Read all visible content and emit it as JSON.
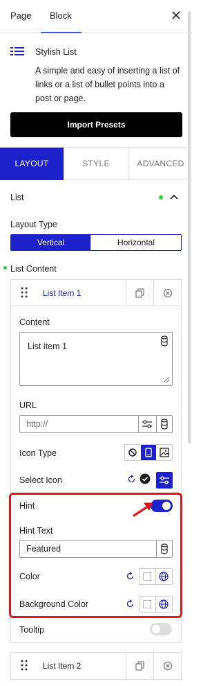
{
  "top_tabs": {
    "page": "Page",
    "block": "Block"
  },
  "block_card": {
    "title": "Stylish List",
    "description": "A simple and easy of inserting a list of links or a list of bullet points into a post or page.",
    "import_button": "Import Presets"
  },
  "main_tabs": {
    "layout": "LAYOUT",
    "style": "STYLE",
    "advanced": "ADVANCED"
  },
  "list_section": {
    "title": "List",
    "layout_type_label": "Layout Type",
    "layout_options": [
      "Vertical",
      "Horizontal"
    ],
    "layout_selected": "Vertical",
    "list_content_label": "List Content"
  },
  "item1": {
    "label": "List Item 1",
    "content_label": "Content",
    "content_value": "List item 1",
    "url_label": "URL",
    "url_placeholder": "http://",
    "icon_type_label": "Icon Type",
    "select_icon_label": "Select Icon",
    "hint_label": "Hint",
    "hint_enabled": true,
    "hint_text_label": "Hint Text",
    "hint_text_value": "Featured",
    "color_label": "Color",
    "bg_color_label": "Background Color",
    "tooltip_label": "Tooltip",
    "tooltip_enabled": false
  },
  "item2": {
    "label": "List Item 2"
  },
  "colors": {
    "accent": "#1d21c9",
    "highlight": "#e4141b",
    "status_dot": "#2ecc40"
  }
}
